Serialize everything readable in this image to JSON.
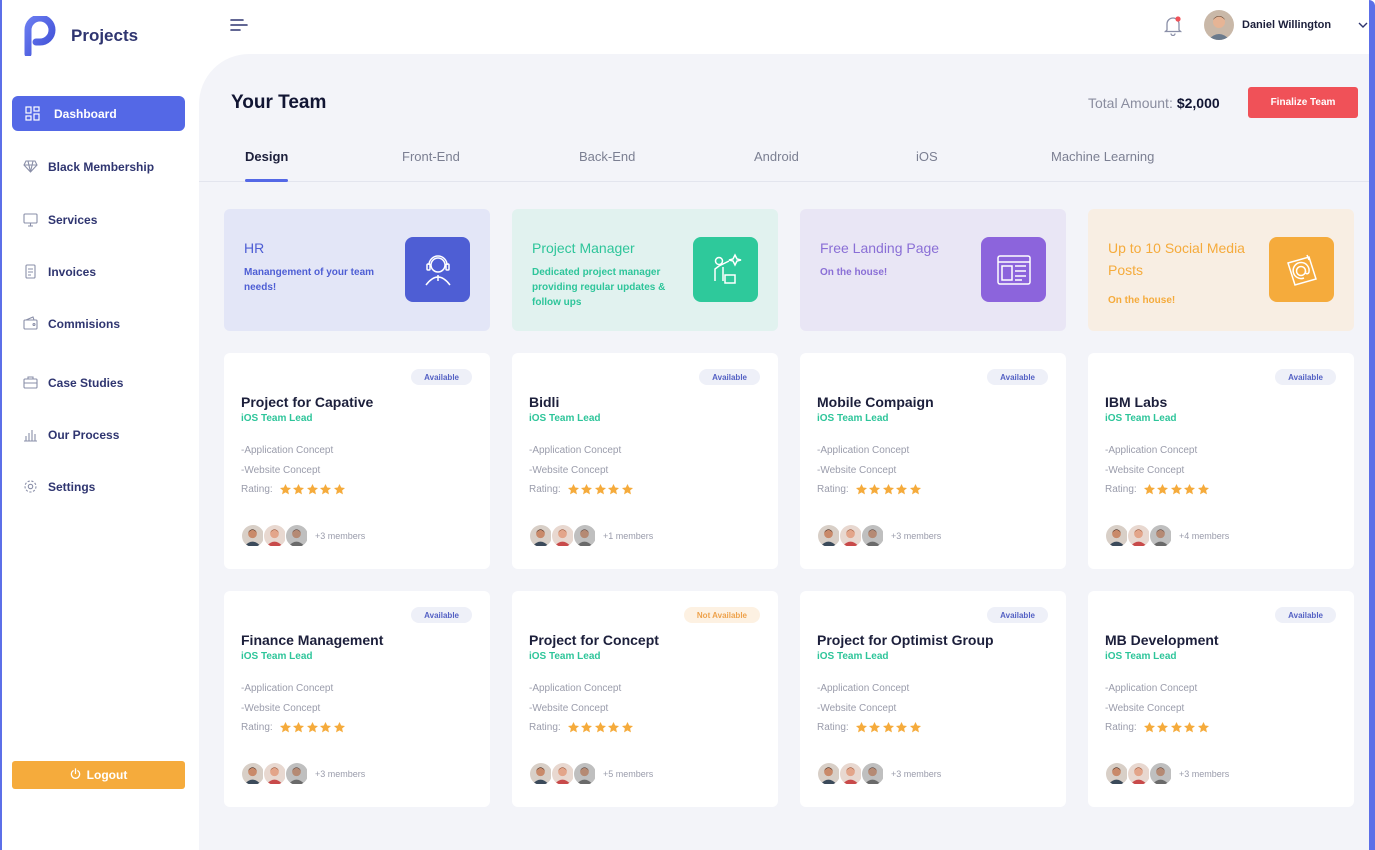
{
  "brand": {
    "title": "Projects"
  },
  "sidebar": {
    "items": [
      {
        "label": "Dashboard",
        "icon": "dashboard-icon",
        "active": true
      },
      {
        "label": "Black Membership",
        "icon": "diamond-icon"
      },
      {
        "label": "Services",
        "icon": "monitor-icon"
      },
      {
        "label": "Invoices",
        "icon": "invoice-icon"
      },
      {
        "label": "Commisions",
        "icon": "wallet-icon"
      },
      {
        "label": "Case Studies",
        "icon": "briefcase-icon"
      },
      {
        "label": "Our Process",
        "icon": "bar-chart-icon"
      },
      {
        "label": "Settings",
        "icon": "gear-icon"
      }
    ],
    "logout_label": "Logout"
  },
  "header": {
    "user_name": "Daniel Willington"
  },
  "main": {
    "title": "Your Team",
    "total_label": "Total Amount:",
    "total_value": "$2,000",
    "finalize_label": "Finalize Team",
    "tabs": [
      {
        "label": "Design",
        "active": true
      },
      {
        "label": "Front-End"
      },
      {
        "label": "Back-End"
      },
      {
        "label": "Android"
      },
      {
        "label": "iOS"
      },
      {
        "label": "Machine Learning"
      }
    ]
  },
  "services": [
    {
      "title": "HR",
      "desc": "Manangement of your team needs!",
      "icon": "support-agent-icon",
      "bg": "#e3e6f7",
      "fg": "#4e5ed4",
      "iconbg": "#4e5ed4"
    },
    {
      "title": "Project Manager",
      "desc": "Dedicated project manager providing regular updates & follow ups",
      "icon": "presenter-icon",
      "bg": "#e1f2ef",
      "fg": "#2ec59a",
      "iconbg": "#2ec99b"
    },
    {
      "title": "Free Landing Page",
      "desc": "On the house!",
      "icon": "webpage-icon",
      "bg": "#e9e6f5",
      "fg": "#8a6fd6",
      "iconbg": "#8c64dc"
    },
    {
      "title": "Up to 10 Social Media Posts",
      "desc": "On the house!",
      "icon": "email-post-icon",
      "bg": "#f8eee3",
      "fg": "#f5ab3c",
      "iconbg": "#f5ab3c"
    }
  ],
  "rating_label": "Rating:",
  "line1": "-Application Concept",
  "line2": "-Website Concept",
  "projects": [
    {
      "title": "Project for Capative",
      "role": "iOS Team Lead",
      "status": "Available",
      "available": true,
      "members": "+3 members",
      "rating": 5
    },
    {
      "title": "Bidli",
      "role": "iOS Team Lead",
      "status": "Available",
      "available": true,
      "members": "+1 members",
      "rating": 5
    },
    {
      "title": "Mobile Compaign",
      "role": "iOS Team Lead",
      "status": "Available",
      "available": true,
      "members": "+3 members",
      "rating": 5
    },
    {
      "title": "IBM Labs",
      "role": "iOS Team Lead",
      "status": "Available",
      "available": true,
      "members": "+4 members",
      "rating": 5
    },
    {
      "title": "Finance Management",
      "role": "iOS Team Lead",
      "status": "Available",
      "available": true,
      "members": "+3 members",
      "rating": 5
    },
    {
      "title": "Project for Concept",
      "role": "iOS Team Lead",
      "status": "Not Available",
      "available": false,
      "members": "+5 members",
      "rating": 5
    },
    {
      "title": "Project for Optimist Group",
      "role": "iOS Team Lead",
      "status": "Available",
      "available": true,
      "members": "+3 members",
      "rating": 5
    },
    {
      "title": "MB Development",
      "role": "iOS Team Lead",
      "status": "Available",
      "available": true,
      "members": "+3 members",
      "rating": 5
    }
  ]
}
